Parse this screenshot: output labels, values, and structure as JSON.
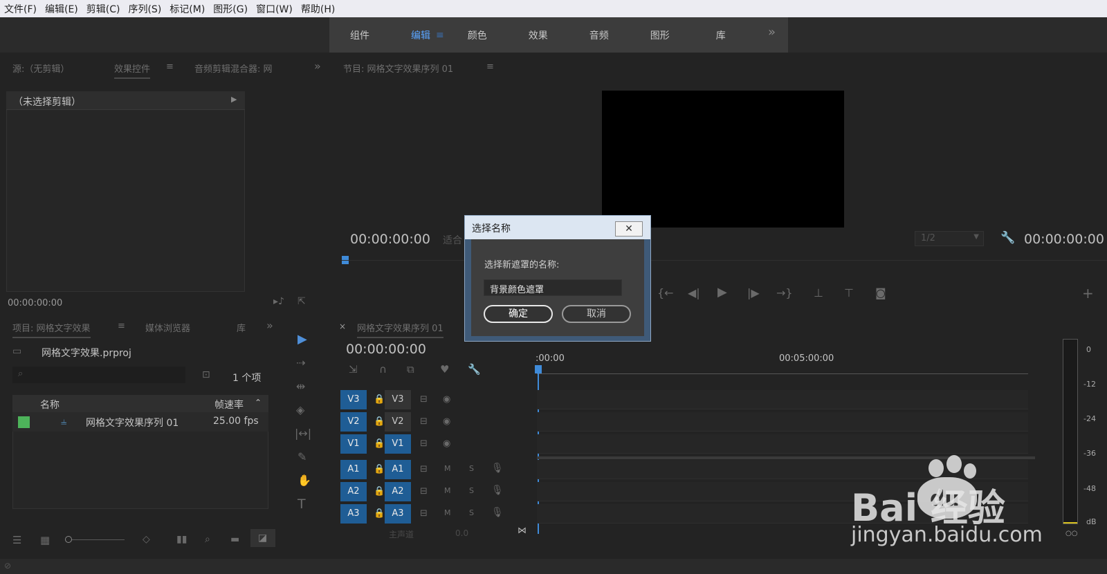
{
  "menu": [
    "文件(F)",
    "编辑(E)",
    "剪辑(C)",
    "序列(S)",
    "标记(M)",
    "图形(G)",
    "窗口(W)",
    "帮助(H)"
  ],
  "workspaces": {
    "tabs": [
      "组件",
      "编辑",
      "颜色",
      "效果",
      "音频",
      "图形",
      "库"
    ],
    "active": "编辑",
    "more": "»"
  },
  "source": {
    "tab_source": "源:（无剪辑）",
    "tab_effects": "效果控件",
    "tab_mixer": "音频剪辑混合器: 网",
    "no_clip": "（未选择剪辑）",
    "timecode": "00:00:00:00"
  },
  "program": {
    "title": "节目: 网格文字效果序列 01",
    "timecode_left": "00:00:00:00",
    "fit": "适合",
    "resolution": "1/2",
    "timecode_right": "00:00:00:00"
  },
  "project": {
    "tab_project": "项目: 网格文字效果",
    "tab_media": "媒体浏览器",
    "tab_lib": "库",
    "file": "网格文字效果.prproj",
    "count": "1 个项",
    "col_name": "名称",
    "col_fps": "帧速率",
    "items": [
      {
        "name": "网格文字效果序列 01",
        "fps": "25.00 fps"
      }
    ]
  },
  "timeline": {
    "tab": "网格文字效果序列 01",
    "timecode": "00:00:00:00",
    "ruler_start": ":00:00",
    "ruler_mark": "00:05:00:00",
    "video_tracks": [
      "V3",
      "V2",
      "V1"
    ],
    "audio_tracks": [
      "A1",
      "A2",
      "A3"
    ],
    "master": "主声道",
    "master_val": "0.0",
    "m_label": "M",
    "s_label": "S"
  },
  "meter": {
    "ticks": [
      "0",
      "-12",
      "-24",
      "-36",
      "-48",
      "dB"
    ]
  },
  "dialog": {
    "title": "选择名称",
    "prompt": "选择新遮罩的名称:",
    "value": "背景颜色遮罩",
    "ok": "确定",
    "cancel": "取消"
  },
  "watermark": {
    "brand": "Bai  经验",
    "du": "du",
    "url": "jingyan.baidu.com"
  }
}
